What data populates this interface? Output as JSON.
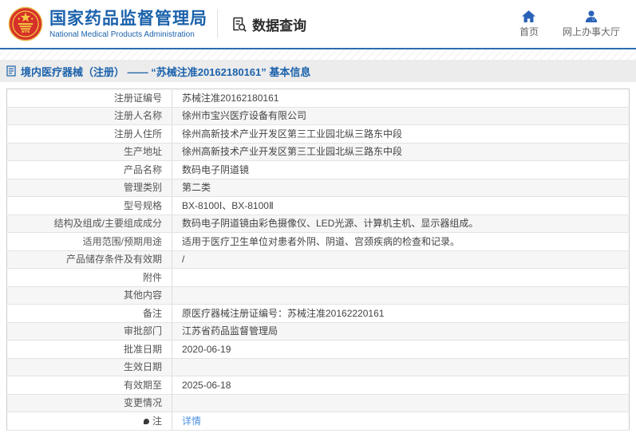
{
  "header": {
    "logo": {
      "title_cn": "国家药品监督管理局",
      "title_en": "National Medical Products Administration"
    },
    "data_query_label": "数据查询",
    "nav": [
      {
        "label": "首页",
        "icon": "home-icon"
      },
      {
        "label": "网上办事大厅",
        "icon": "person-icon"
      }
    ]
  },
  "breadcrumb": {
    "icon": "document-icon",
    "text": "境内医疗器械（注册） —— “苏械注准20162180161” 基本信息"
  },
  "colors": {
    "brand_blue": "#1b62ab",
    "header_border_blue": "#2b6cb0",
    "nav_icon_blue": "#2a62b8",
    "link_blue": "#4a90e2",
    "breadcrumb_bg": "#ececec",
    "row_alt_bg": "#f6f6f6",
    "table_border": "#cccccc",
    "emblem_red": "#d6302a",
    "emblem_gold": "#f5c842"
  },
  "table": {
    "rows": [
      {
        "label": "注册证编号",
        "value": "苏械注准20162180161"
      },
      {
        "label": "注册人名称",
        "value": "徐州市宝兴医疗设备有限公司"
      },
      {
        "label": "注册人住所",
        "value": "徐州高新技术产业开发区第三工业园北纵三路东中段"
      },
      {
        "label": "生产地址",
        "value": "徐州高新技术产业开发区第三工业园北纵三路东中段"
      },
      {
        "label": "产品名称",
        "value": "数码电子阴道镜"
      },
      {
        "label": "管理类别",
        "value": "第二类"
      },
      {
        "label": "型号规格",
        "value": "BX-8100Ⅰ、BX-8100Ⅱ"
      },
      {
        "label": "结构及组成/主要组成成分",
        "value": "数码电子阴道镜由彩色摄像仪、LED光源、计算机主机、显示器组成。"
      },
      {
        "label": "适用范围/预期用途",
        "value": "适用于医疗卫生单位对患者外阴、阴道、宫颈疾病的检查和记录。"
      },
      {
        "label": "产品储存条件及有效期",
        "value": "/"
      },
      {
        "label": "附件",
        "value": ""
      },
      {
        "label": "其他内容",
        "value": ""
      },
      {
        "label": "备注",
        "value": "原医疗器械注册证编号：苏械注准20162220161"
      },
      {
        "label": "审批部门",
        "value": "江苏省药品监督管理局"
      },
      {
        "label": "批准日期",
        "value": "2020-06-19"
      },
      {
        "label": "生效日期",
        "value": ""
      },
      {
        "label": "有效期至",
        "value": "2025-06-18"
      },
      {
        "label": "变更情况",
        "value": ""
      },
      {
        "label": "注",
        "value": "详情",
        "label_icon": "note-dot-icon",
        "value_is_link": true
      }
    ]
  }
}
